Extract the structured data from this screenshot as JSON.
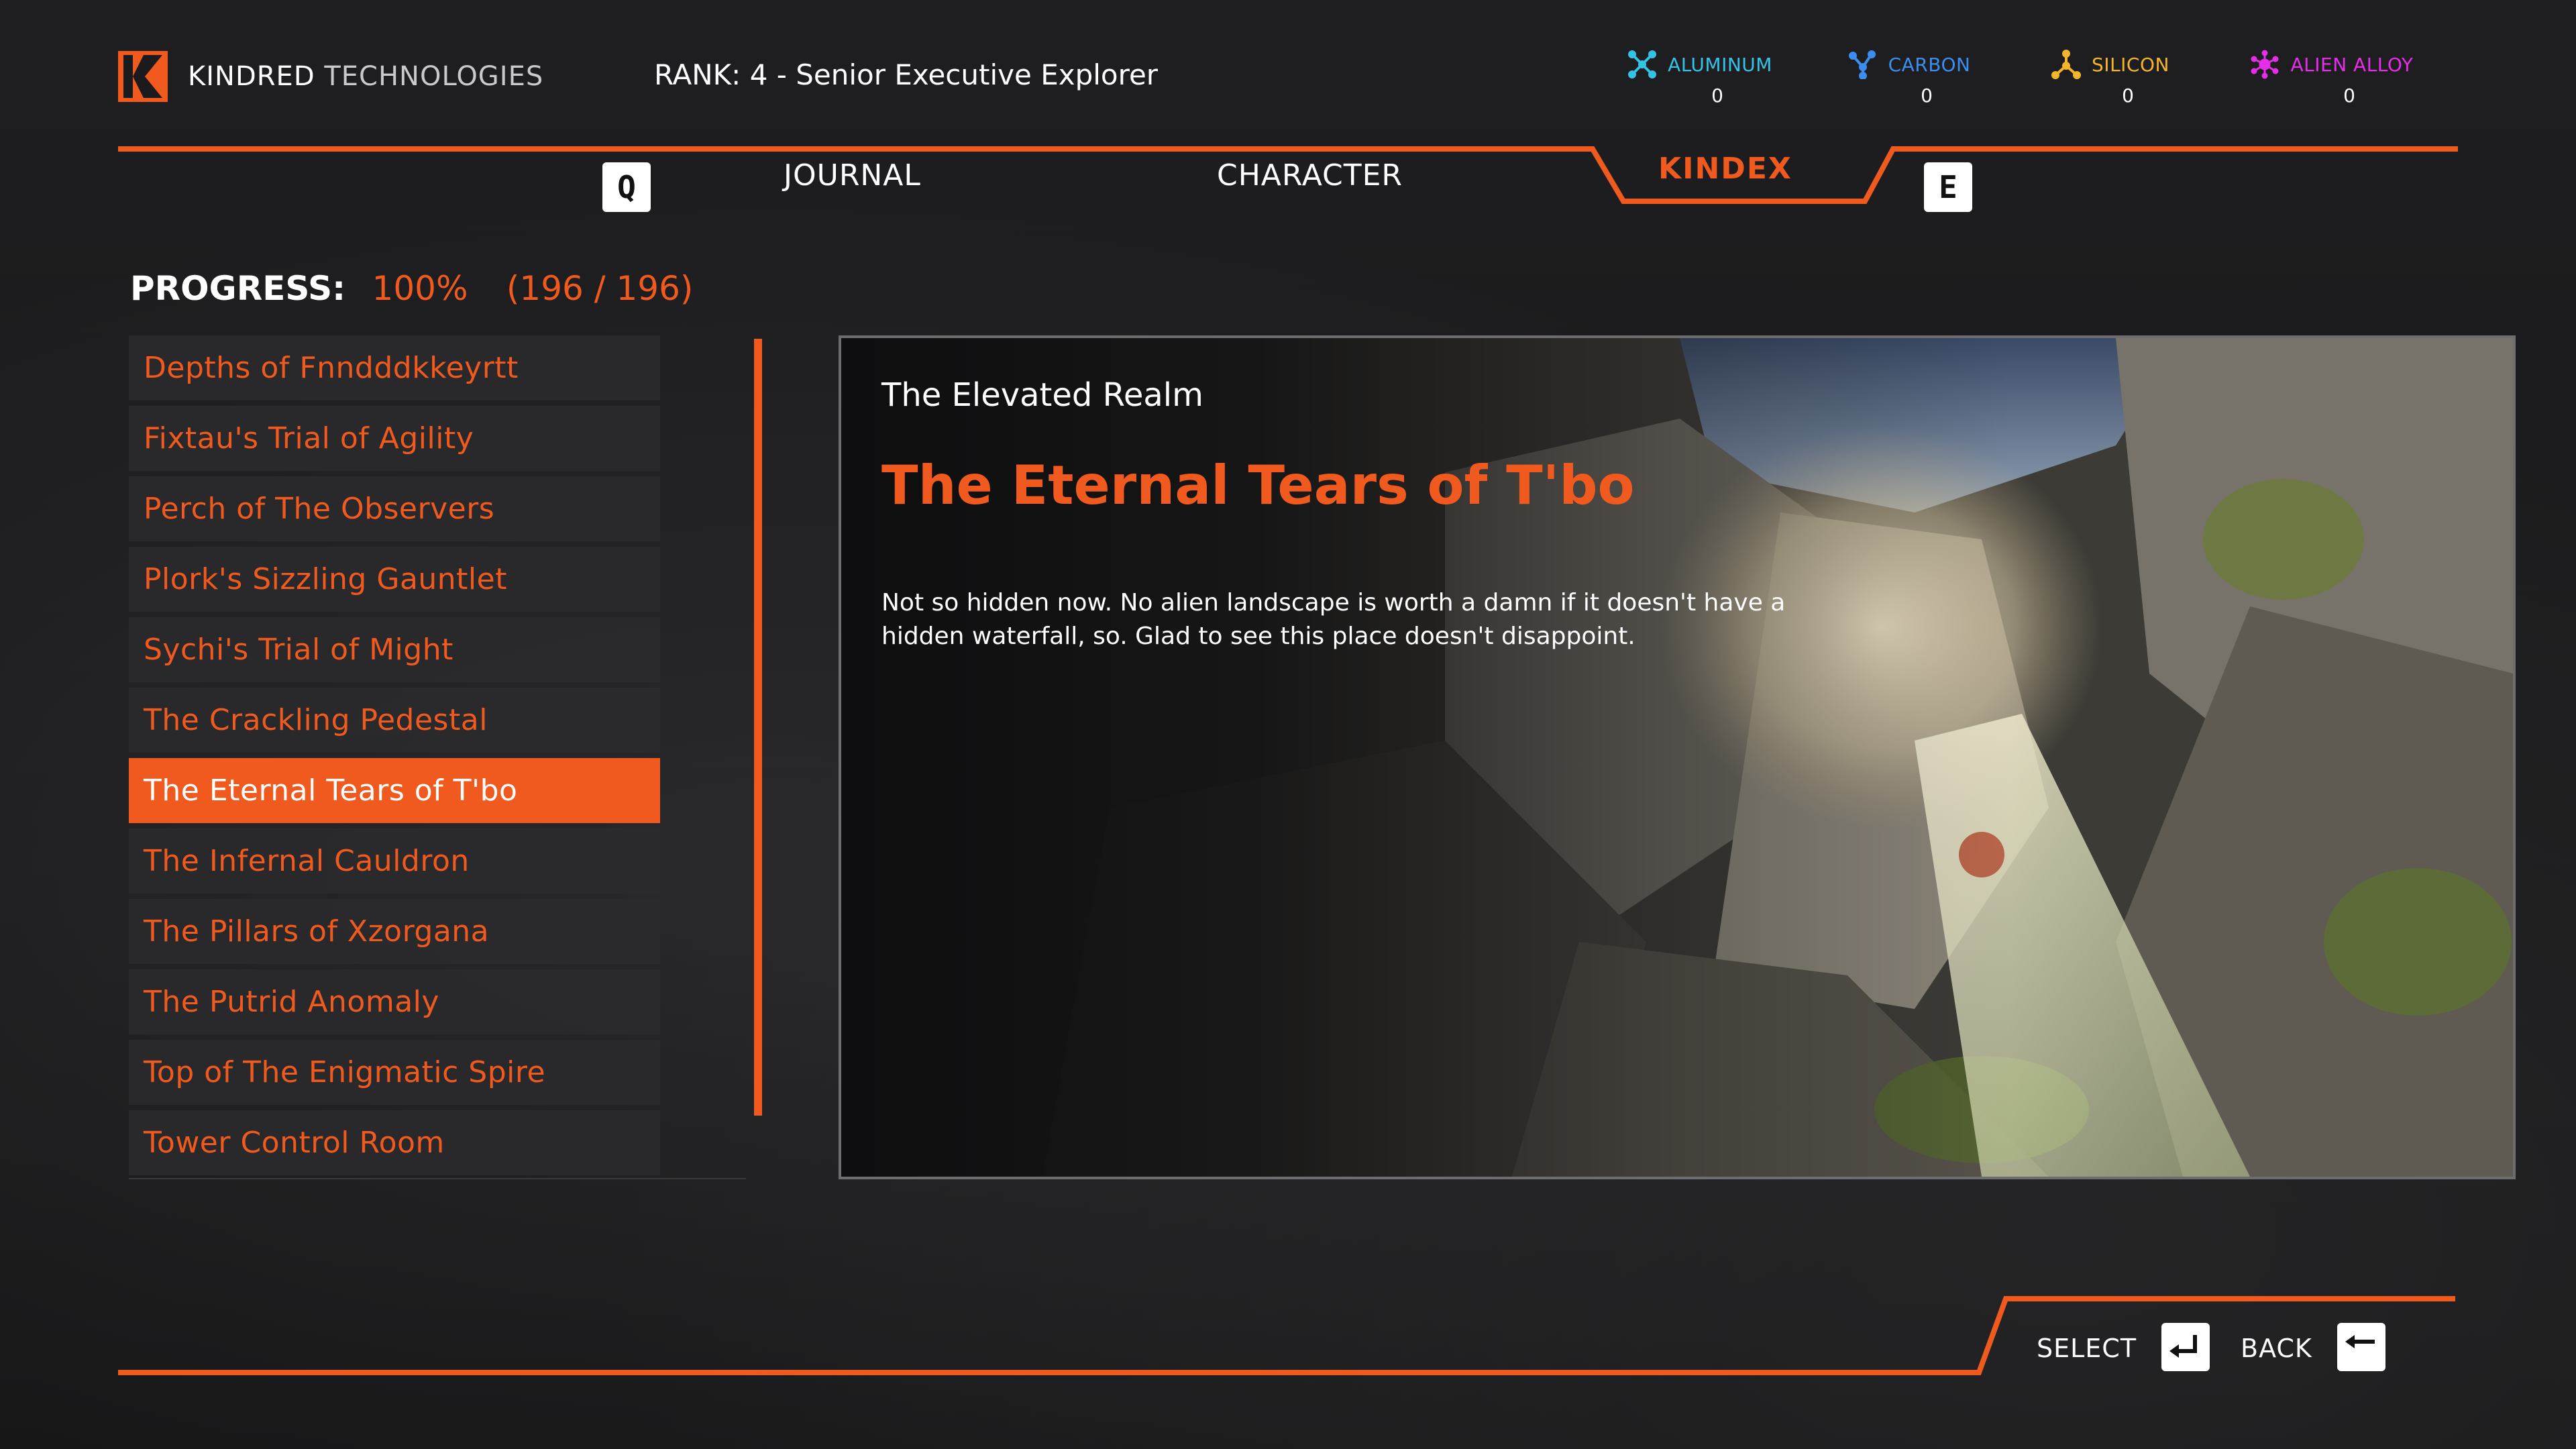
{
  "header": {
    "brand_primary": "KINDRED",
    "brand_secondary": "TECHNOLOGIES",
    "rank_label": "RANK:",
    "rank_value": "4 - Senior Executive Explorer"
  },
  "resources": [
    {
      "name": "ALUMINUM",
      "value": "0",
      "color": "#33c3e6",
      "icon": "aluminum-molecule-icon"
    },
    {
      "name": "CARBON",
      "value": "0",
      "color": "#3a8ef0",
      "icon": "carbon-molecule-icon"
    },
    {
      "name": "SILICON",
      "value": "0",
      "color": "#f5b52a",
      "icon": "silicon-molecule-icon"
    },
    {
      "name": "ALIEN ALLOY",
      "value": "0",
      "color": "#e62ee8",
      "icon": "alien-alloy-molecule-icon"
    }
  ],
  "tabs": {
    "prev_key": "Q",
    "next_key": "E",
    "items": [
      {
        "label": "JOURNAL"
      },
      {
        "label": "CHARACTER"
      },
      {
        "label": "KINDEX",
        "active": true
      }
    ]
  },
  "progress": {
    "label": "PROGRESS:",
    "percent_text": "100%",
    "fraction_text": "(196 / 196)",
    "completed": 196,
    "total": 196
  },
  "locations": [
    {
      "label": "Depths of Fnndddkkeyrtt"
    },
    {
      "label": "Fixtau's Trial of Agility"
    },
    {
      "label": "Perch of The Observers"
    },
    {
      "label": "Plork's Sizzling Gauntlet"
    },
    {
      "label": "Sychi's Trial of Might"
    },
    {
      "label": "The Crackling Pedestal"
    },
    {
      "label": "The Eternal Tears of T'bo",
      "selected": true
    },
    {
      "label": "The Infernal Cauldron"
    },
    {
      "label": "The Pillars of Xzorgana"
    },
    {
      "label": "The Putrid Anomaly"
    },
    {
      "label": "Top of The Enigmatic Spire"
    },
    {
      "label": "Tower Control Room"
    }
  ],
  "detail": {
    "realm": "The Elevated Realm",
    "title": "The Eternal Tears of T'bo",
    "description": "Not so hidden now. No alien landscape is worth a damn if it doesn't have a hidden waterfall, so. Glad to see this place doesn't disappoint."
  },
  "footer": {
    "select_label": "SELECT",
    "back_label": "BACK"
  },
  "colors": {
    "accent": "#f05a1e",
    "panel_border": "#6d6d70",
    "list_bg": "#2a2a2d"
  }
}
